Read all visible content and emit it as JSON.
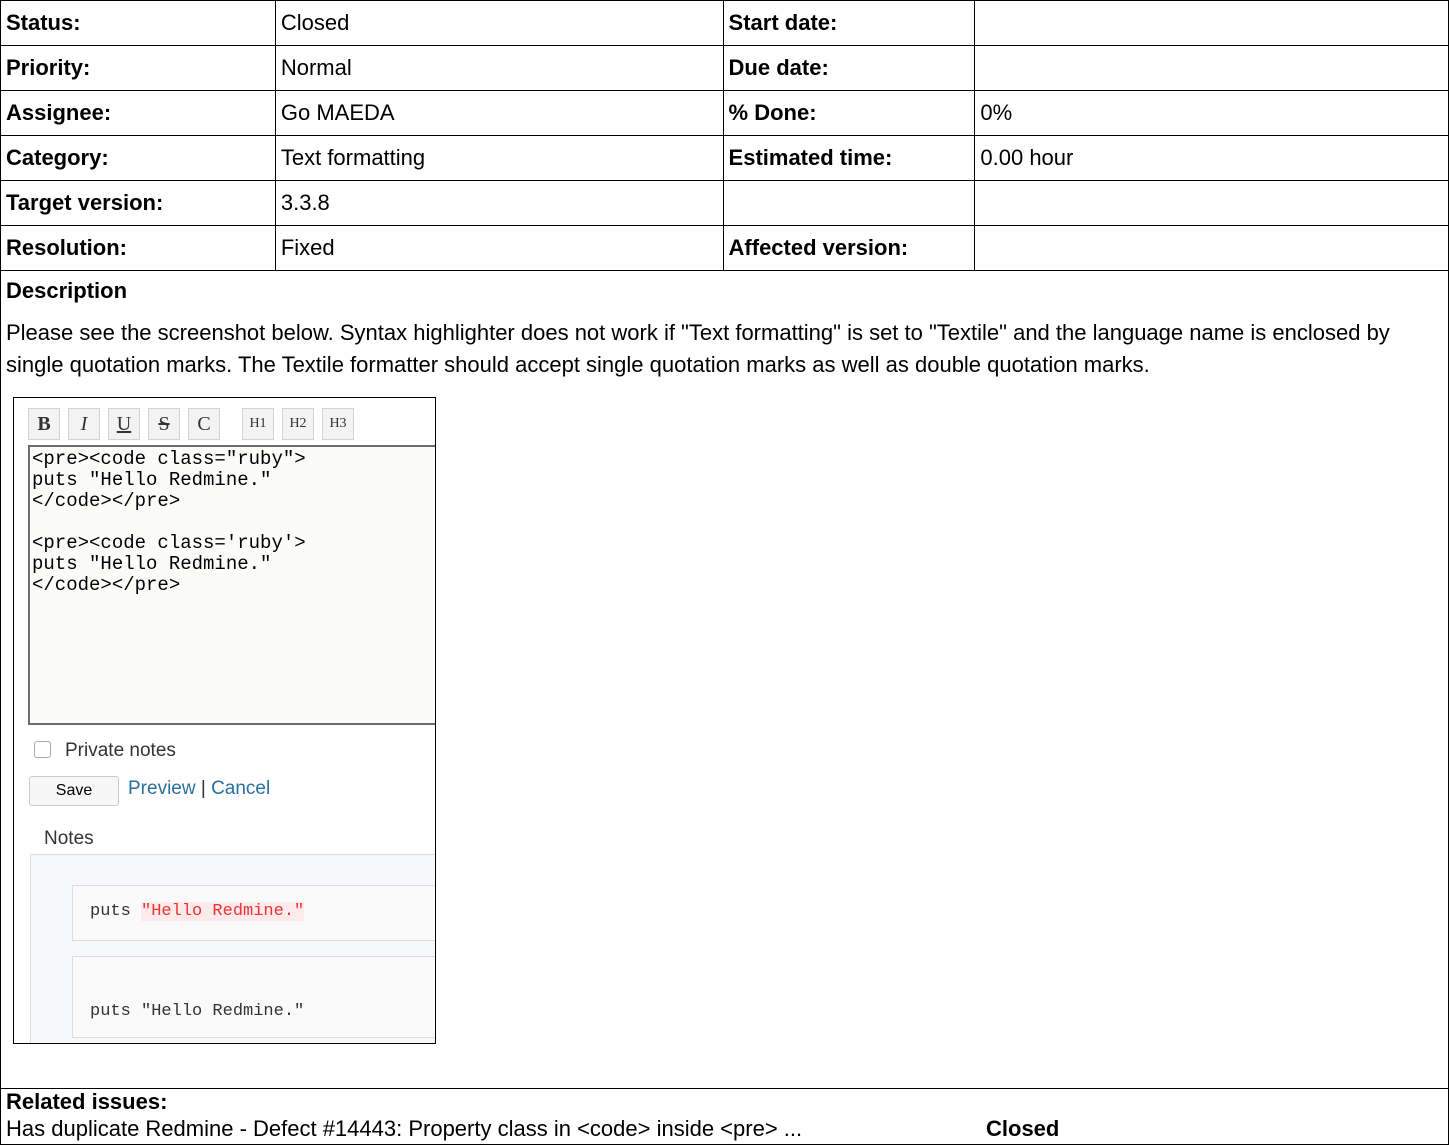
{
  "attributes": {
    "status_label": "Status:",
    "status_value": "Closed",
    "start_date_label": "Start date:",
    "start_date_value": "",
    "priority_label": "Priority:",
    "priority_value": "Normal",
    "due_date_label": "Due date:",
    "due_date_value": "",
    "assignee_label": "Assignee:",
    "assignee_value": "Go MAEDA",
    "done_label": "% Done:",
    "done_value": "0%",
    "category_label": "Category:",
    "category_value": "Text formatting",
    "estimated_label": "Estimated time:",
    "estimated_value": "0.00 hour",
    "target_label": "Target version:",
    "target_value": "3.3.8",
    "resolution_label": "Resolution:",
    "resolution_value": "Fixed",
    "affected_label": "Affected version:",
    "affected_value": ""
  },
  "description": {
    "title": "Description",
    "text": "Please see the screenshot below. Syntax highlighter does not work if \"Text formatting\" is set to \"Textile\" and the language name is enclosed by single quotation marks. The Textile formatter should accept single quotation marks as well as double quotation marks."
  },
  "screenshot": {
    "toolbar": [
      "B",
      "I",
      "U",
      "S",
      "C",
      "H1",
      "H2",
      "H3"
    ],
    "editor_text": "<pre><code class=\"ruby\">\nputs \"Hello Redmine.\"\n</code></pre>\n\n<pre><code class='ruby'>\nputs \"Hello Redmine.\"\n</code></pre>",
    "private_notes": "Private notes",
    "save": "Save",
    "preview": "Preview",
    "separator": "|",
    "cancel": "Cancel",
    "notes_legend": "Notes",
    "code1_keyword": "puts",
    "code1_string": "\"Hello Redmine.\"",
    "code2": "puts \"Hello Redmine.\""
  },
  "related": {
    "title": "Related issues:",
    "item": "Has duplicate Redmine - Defect #14443: Property class in <code> inside <pre> ...",
    "item_status": "Closed"
  }
}
